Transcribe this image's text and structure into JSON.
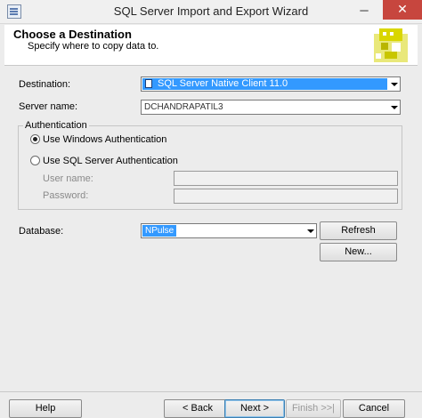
{
  "window": {
    "title": "SQL Server Import and Export Wizard",
    "minimize": "─",
    "close": "✕"
  },
  "header": {
    "title": "Choose a Destination",
    "subtitle": "Specify where to copy data to."
  },
  "form": {
    "destination_label": "Destination:",
    "destination_value": "SQL Server Native Client 11.0",
    "server_label": "Server name:",
    "server_value": "DCHANDRAPATIL3",
    "auth_group_label": "Authentication",
    "windows_auth_label": "Use Windows Authentication",
    "sql_auth_label": "Use SQL Server Authentication",
    "selected_auth": "windows",
    "username_label": "User name:",
    "password_label": "Password:",
    "database_label": "Database:",
    "database_value": "NPulse",
    "refresh_label": "Refresh",
    "new_label": "New..."
  },
  "footer": {
    "help": "Help",
    "back": "< Back",
    "next": "Next >",
    "finish": "Finish >>|",
    "cancel": "Cancel"
  },
  "colors": {
    "selection": "#3399ff",
    "close": "#c7463e",
    "graphic": "#d9d600"
  },
  "icons": {
    "app": "window-app-icon",
    "destination_item": "sql-server-icon",
    "wizard": "wizard-graphic-icon"
  }
}
